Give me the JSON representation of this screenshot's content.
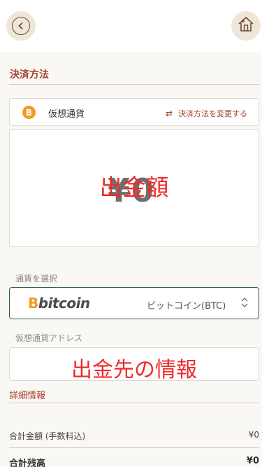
{
  "header": {
    "back_icon": "chevron-left-icon",
    "home_icon": "house-icon"
  },
  "payment": {
    "section_title": "決済方法",
    "method_label": "仮想通貨",
    "method_icon_glyph": "B",
    "change_label": "決済方法を変更する",
    "change_icon_glyph": "⇄"
  },
  "amount": {
    "background_value": "¥0",
    "overlay_label": "出金額"
  },
  "currency": {
    "field_label": "通貨を選択",
    "logo_b": "B",
    "logo_text": "bitcoin",
    "selected_value": "ビットコイン(BTC)",
    "chevron_glyph": "⌃⌄"
  },
  "address": {
    "field_label": "仮想通貨アドレス",
    "overlay_label": "出金先の情報"
  },
  "details": {
    "link_label": "詳細情報"
  },
  "summary": {
    "total_label": "合計金額 (手数料込)",
    "total_value": "¥0",
    "balance_label": "合計残高",
    "balance_value": "¥0"
  },
  "colors": {
    "accent": "#a5402c",
    "bitcoin_orange": "#f39a1f",
    "overlay_red": "#ee2a2a",
    "select_border": "#2f5d46"
  }
}
